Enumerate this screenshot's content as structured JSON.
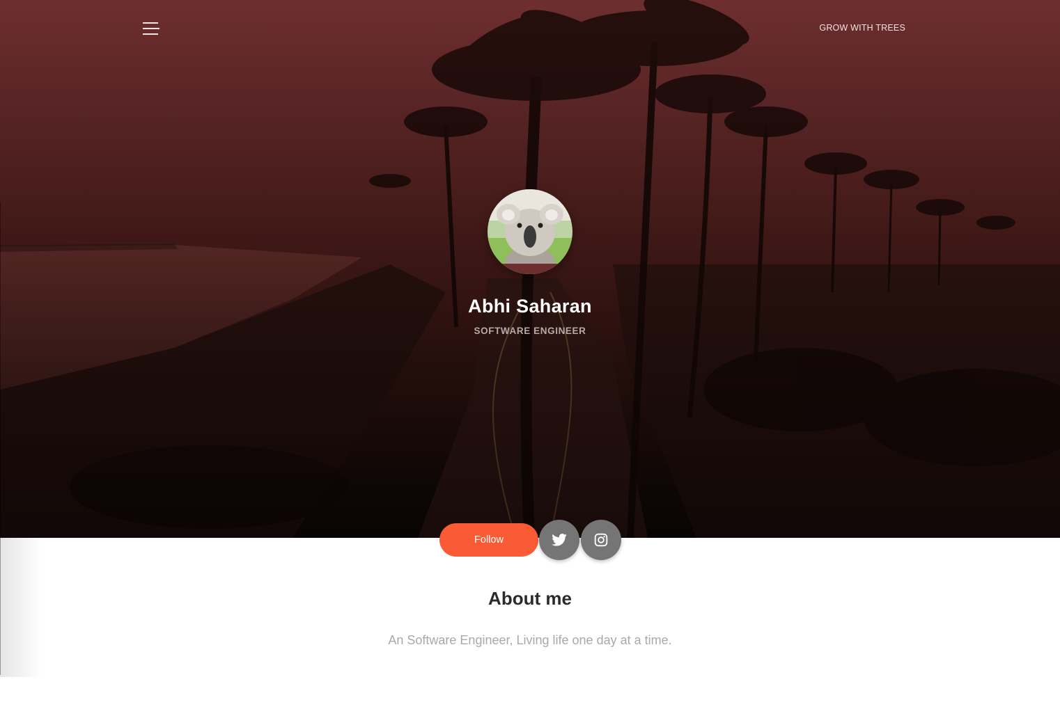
{
  "header": {
    "brand_link": "GROW WITH TREES"
  },
  "profile": {
    "name": "Abhi Saharan",
    "role": "SOFTWARE ENGINEER"
  },
  "actions": {
    "follow_label": "Follow",
    "social": [
      "twitter-icon",
      "instagram-icon"
    ]
  },
  "about": {
    "title": "About me",
    "text": "An Software Engineer, Living life one day at a time."
  },
  "colors": {
    "accent": "#fa5b35",
    "social_button": "#757575",
    "hero_tint": "#5a2422"
  }
}
